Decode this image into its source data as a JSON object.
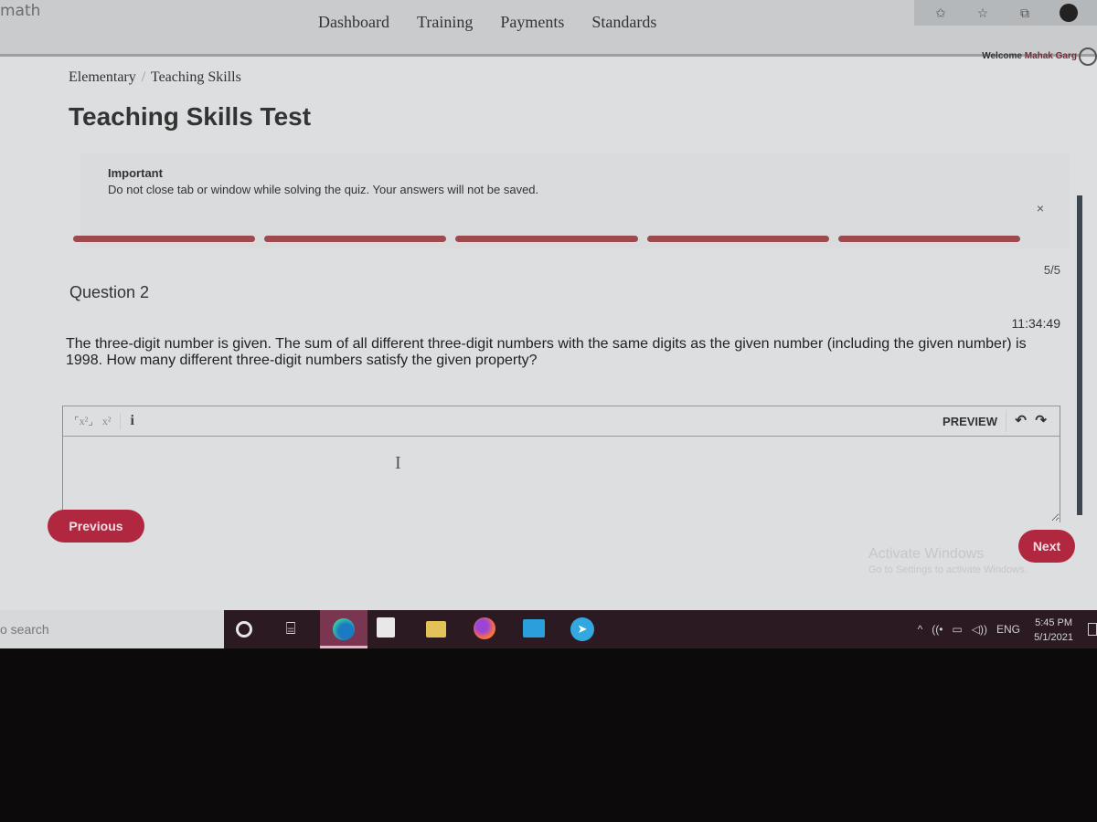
{
  "app": {
    "brand": "math",
    "nav": [
      "Dashboard",
      "Training",
      "Payments",
      "Standards"
    ],
    "browser_icons": [
      "extension-icon",
      "favorites-icon",
      "collections-icon",
      "profile-icon"
    ],
    "welcome_prefix": "Welcome",
    "user_name": "Mahak Garg"
  },
  "breadcrumb": {
    "level1": "Elementary",
    "separator": "/",
    "level2": "Teaching Skills"
  },
  "page_title": "Teaching Skills Test",
  "alert": {
    "title": "Important",
    "text": "Do not close tab or window while solving the quiz. Your answers will not be saved.",
    "close": "×"
  },
  "progress": {
    "segments_total": 5,
    "segments_filled": 5,
    "count_text": "5/5",
    "fill_color": "#9c4a4e"
  },
  "question": {
    "label": "Question 2",
    "timer": "11:34:49",
    "text": "The three-digit number is given. The sum of all different three-digit numbers with the same digits as the given number (including the given number) is 1998. How many different three-digit numbers satisfy the given property?"
  },
  "editor": {
    "toolbar": {
      "subscript_matrix": "⌜x²⌟",
      "superscript": "x²",
      "info": "i",
      "preview": "PREVIEW",
      "undo": "↶",
      "redo": "↷"
    },
    "value": "",
    "cursor_glyph": "I"
  },
  "buttons": {
    "previous": "Previous",
    "next": "Next",
    "accent_color": "#b0273f"
  },
  "watermark": {
    "line1": "Activate Windows",
    "line2": "Go to Settings to activate Windows."
  },
  "taskbar": {
    "search_placeholder": "o search",
    "apps": [
      "cortana",
      "task-view",
      "edge",
      "store",
      "file-explorer",
      "firefox",
      "mail",
      "telegram"
    ],
    "tray": {
      "chevron": "^",
      "wifi": "((•",
      "battery": "▭",
      "volume": "◁))",
      "language": "ENG"
    },
    "time": "5:45 PM",
    "date": "5/1/2021"
  }
}
